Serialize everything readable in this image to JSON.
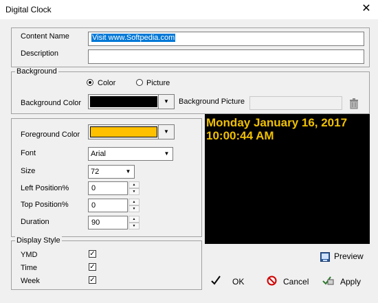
{
  "window": {
    "title": "Digital Clock"
  },
  "content": {
    "name_label": "Content Name",
    "name_value": "Visit www.Softpedia.com",
    "description_label": "Description",
    "description_value": ""
  },
  "background": {
    "group_label": "Background",
    "radio_color": "Color",
    "radio_picture": "Picture",
    "selected": "Color",
    "color_label": "Background Color",
    "color_value": "#000000",
    "picture_label": "Background Picture",
    "picture_value": ""
  },
  "settings": {
    "foreground_label": "Foreground Color",
    "foreground_value": "#ffc000",
    "font_label": "Font",
    "font_value": "Arial",
    "size_label": "Size",
    "size_value": "72",
    "left_label": "Left Position%",
    "left_value": "0",
    "top_label": "Top Position%",
    "top_value": "0",
    "duration_label": "Duration",
    "duration_value": "90"
  },
  "display_style": {
    "group_label": "Display Style",
    "ymd_label": "YMD",
    "ymd_checked": true,
    "time_label": "Time",
    "time_checked": true,
    "week_label": "Week",
    "week_checked": true
  },
  "preview": {
    "date_line": "Monday January 16, 2017",
    "time_line": "10:00:44 AM",
    "text_color": "#f0c000",
    "background_color": "#000000"
  },
  "buttons": {
    "preview": "Preview",
    "ok": "OK",
    "cancel": "Cancel",
    "apply": "Apply"
  },
  "icons": {
    "close": "close-icon",
    "trash": "trash-icon",
    "preview": "preview-icon",
    "ok": "checkmark-icon",
    "cancel": "no-entry-icon",
    "apply": "apply-icon"
  }
}
